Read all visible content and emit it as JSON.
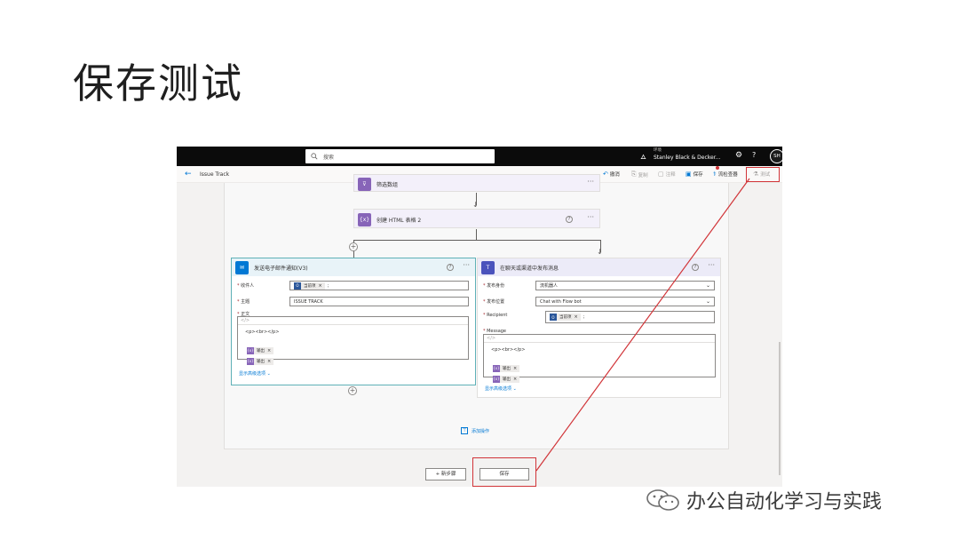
{
  "slide": {
    "title": "保存测试"
  },
  "topbar": {
    "search_placeholder": "搜索",
    "env_label": "环境",
    "env_name": "Stanley Black & Decker...",
    "avatar": "SH",
    "help": "?"
  },
  "cmdbar": {
    "flow_name": "Issue Track",
    "undo": "撤消",
    "copy": "复制",
    "comment": "注释",
    "save": "保存",
    "checker": "流检查器",
    "test": "测试"
  },
  "cards": {
    "filter": {
      "title": "筛选数组"
    },
    "html_table": {
      "title": "创建 HTML 表格 2",
      "icon": "{x}"
    },
    "email": {
      "title": "发送电子邮件通知(V3)",
      "to_label": "收件人",
      "to_chip": "当前项",
      "subject_label": "主题",
      "subject_value": "ISSUE TRACK",
      "body_label": "正文",
      "body_code": "<p><br></p>",
      "body_chip_1": "输出",
      "body_chip_2": "输出",
      "advanced": "显示高级选项"
    },
    "teams": {
      "title": "在聊天或渠道中发布消息",
      "post_as_label": "发布身份",
      "post_as_value": "流机器人",
      "post_in_label": "发布位置",
      "post_in_value": "Chat with Flow bot",
      "recipient_label": "Recipient",
      "recipient_chip": "当前项",
      "message_label": "Message",
      "message_code": "<p><br></p>",
      "message_chip_1": "输出",
      "message_chip_2": "输出",
      "advanced": "显示高级选项"
    }
  },
  "canvas": {
    "add_action": "添加操作",
    "new_step": "+ 新步骤",
    "save_button": "保存"
  },
  "watermark": {
    "text": "办公自动化学习与实践"
  },
  "colors": {
    "accent": "#0078d4",
    "highlight_red": "#d13438",
    "email_card": "#0078d4",
    "teams_card": "#4b53bc",
    "variable_card": "#8764b8",
    "email_border": "#5fb1b7"
  }
}
